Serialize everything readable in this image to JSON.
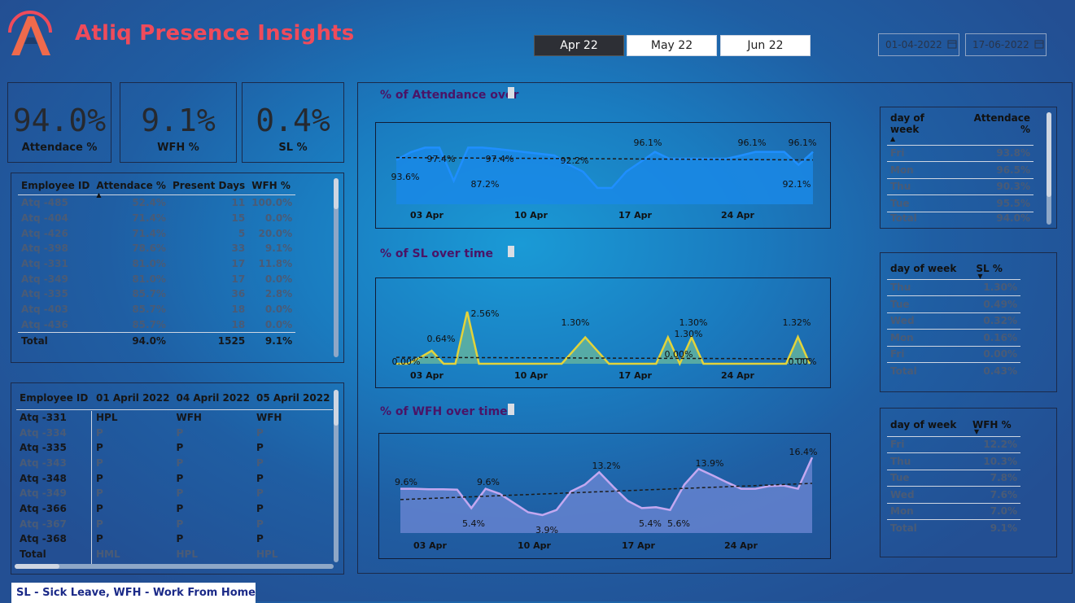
{
  "app": {
    "title": "Atliq Presence Insights",
    "logo_text": "A"
  },
  "months": [
    "Apr 22",
    "May 22",
    "Jun 22"
  ],
  "active_month": "Apr 22",
  "dates": {
    "start": "01-04-2022",
    "end": "17-06-2022"
  },
  "kpis": [
    {
      "value": "94.0%",
      "label": "Attendace %"
    },
    {
      "value": "9.1%",
      "label": "WFH %"
    },
    {
      "value": "0.4%",
      "label": "SL %"
    }
  ],
  "employee_table": {
    "headers": [
      "Employee ID",
      "Attendace %",
      "Present Days",
      "WFH %"
    ],
    "rows": [
      [
        "Atq -485",
        "52.4%",
        "11",
        "100.0%"
      ],
      [
        "Atq -404",
        "71.4%",
        "15",
        "0.0%"
      ],
      [
        "Atq -426",
        "71.4%",
        "5",
        "20.0%"
      ],
      [
        "Atq -398",
        "78.6%",
        "33",
        "9.1%"
      ],
      [
        "Atq -331",
        "81.0%",
        "17",
        "11.8%"
      ],
      [
        "Atq -349",
        "81.0%",
        "17",
        "0.0%"
      ],
      [
        "Atq -335",
        "85.7%",
        "36",
        "2.8%"
      ],
      [
        "Atq -403",
        "85.7%",
        "18",
        "0.0%"
      ],
      [
        "Atq -436",
        "85.7%",
        "18",
        "0.0%"
      ]
    ],
    "total": [
      "Total",
      "94.0%",
      "1525",
      "9.1%"
    ]
  },
  "daily_table": {
    "headers": [
      "Employee ID",
      "01 April 2022",
      "04 April 2022",
      "05 April 2022"
    ],
    "rows": [
      [
        "Atq -331",
        "HPL",
        "WFH",
        "WFH"
      ],
      [
        "Atq -334",
        "P",
        "P",
        "P"
      ],
      [
        "Atq -335",
        "P",
        "P",
        "P"
      ],
      [
        "Atq -343",
        "P",
        "P",
        "P"
      ],
      [
        "Atq -348",
        "P",
        "P",
        "P"
      ],
      [
        "Atq -349",
        "P",
        "P",
        "P"
      ],
      [
        "Atq -366",
        "P",
        "P",
        "P"
      ],
      [
        "Atq -367",
        "P",
        "P",
        "P"
      ],
      [
        "Atq -368",
        "P",
        "P",
        "P"
      ]
    ],
    "total": [
      "Total",
      "HML",
      "HPL",
      "HPL"
    ]
  },
  "charts": {
    "attendance_title": "% of Attendance over",
    "sl_title": "% of SL over time",
    "wfh_title": "% of WFH over time"
  },
  "chart_data": [
    {
      "type": "area",
      "title": "% of Attendance over",
      "x_ticks": [
        "03 Apr",
        "10 Apr",
        "17 Apr",
        "24 Apr"
      ],
      "values": [
        93.6,
        96.0,
        97.4,
        97.4,
        87.2,
        97.4,
        97.4,
        97.0,
        96.5,
        96.0,
        95.5,
        95.0,
        92.2,
        90.0,
        85.0,
        85.0,
        90.0,
        93.0,
        96.1,
        94.0,
        94.0,
        94.0,
        94.0,
        94.0,
        95.0,
        96.1,
        96.1,
        96.1,
        92.1,
        96.1
      ],
      "data_labels": [
        "93.6%",
        "97.4%",
        "87.2%",
        "97.4%",
        "92.2%",
        "96.1%",
        "96.1%",
        "92.1%",
        "96.1%"
      ],
      "ylim": [
        80,
        100
      ],
      "trend_line": true
    },
    {
      "type": "area",
      "title": "% of SL over time",
      "x_ticks": [
        "03 Apr",
        "10 Apr",
        "17 Apr",
        "24 Apr"
      ],
      "values": [
        0.0,
        0.0,
        0.3,
        0.64,
        0.0,
        0.0,
        2.56,
        0.0,
        0.0,
        0.0,
        0.0,
        0.0,
        0.0,
        0.0,
        0.0,
        0.65,
        1.3,
        0.65,
        0.0,
        0.0,
        0.0,
        0.0,
        0.0,
        1.3,
        0.0,
        1.3,
        0.0,
        0.0,
        0.0,
        0.0,
        0.0,
        0.0,
        0.0,
        0.0,
        1.32,
        0.0
      ],
      "data_labels": [
        "0.00%",
        "0.64%",
        "2.56%",
        "1.30%",
        "1.30%",
        "1.30%",
        "0.00%",
        "1.32%",
        "0.00%"
      ],
      "ylim": [
        0,
        3
      ],
      "trend_line": true
    },
    {
      "type": "area",
      "title": "% of WFH over time",
      "x_ticks": [
        "03 Apr",
        "10 Apr",
        "17 Apr",
        "24 Apr"
      ],
      "values": [
        9.6,
        9.6,
        9.5,
        9.5,
        9.4,
        5.4,
        9.6,
        8.5,
        6.5,
        4.5,
        3.9,
        5.0,
        9.0,
        10.5,
        13.2,
        10.0,
        7.0,
        5.4,
        5.6,
        5.0,
        10.5,
        13.9,
        12.5,
        11.0,
        9.6,
        9.6,
        10.2,
        10.3,
        9.6,
        16.4
      ],
      "data_labels": [
        "9.6%",
        "9.6%",
        "5.4%",
        "3.9%",
        "13.2%",
        "5.4%",
        "5.6%",
        "13.9%",
        "16.4%"
      ],
      "ylim": [
        0,
        18
      ],
      "trend_line": true
    }
  ],
  "day_attendance": {
    "headers": [
      "day of week",
      "Attendace %"
    ],
    "rows": [
      [
        "Fri",
        "93.8%"
      ],
      [
        "Mon",
        "96.5%"
      ],
      [
        "Thu",
        "90.3%"
      ],
      [
        "Tue",
        "95.5%"
      ]
    ],
    "total": [
      "Total",
      "94.0%"
    ]
  },
  "day_sl": {
    "headers": [
      "day of week",
      "SL %"
    ],
    "rows": [
      [
        "Thu",
        "1.30%"
      ],
      [
        "Tue",
        "0.49%"
      ],
      [
        "Wed",
        "0.32%"
      ],
      [
        "Mon",
        "0.16%"
      ],
      [
        "Fri",
        "0.00%"
      ]
    ],
    "total": [
      "Total",
      "0.43%"
    ]
  },
  "day_wfh": {
    "headers": [
      "day of week",
      "WFH %"
    ],
    "rows": [
      [
        "Fri",
        "12.2%"
      ],
      [
        "Thu",
        "10.3%"
      ],
      [
        "Tue",
        "7.8%"
      ],
      [
        "Wed",
        "7.6%"
      ],
      [
        "Mon",
        "7.0%"
      ]
    ],
    "total": [
      "Total",
      "9.1%"
    ]
  },
  "legend_note": "SL - Sick Leave, WFH - Work From Home",
  "colors": {
    "title": "#ef4b5b",
    "attendance": "#1e90e8",
    "sl_line": "#e8d840",
    "wfh_line": "#b9a2ee"
  }
}
